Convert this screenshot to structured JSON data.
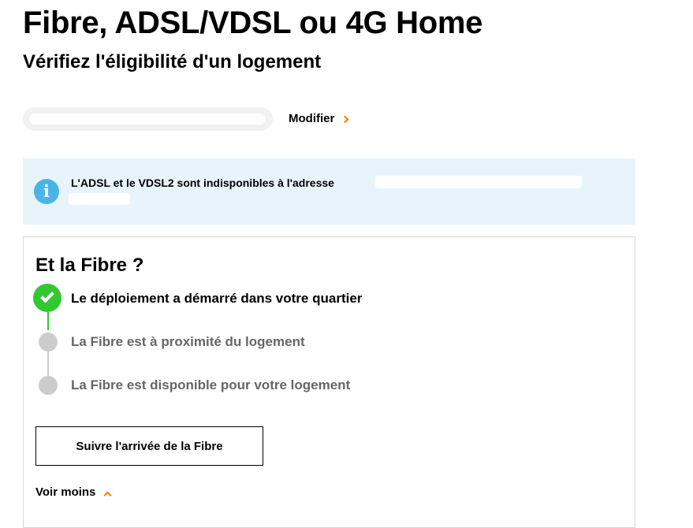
{
  "header": {
    "title": "Fibre, ADSL/VDSL ou 4G Home",
    "subtitle": "Vérifiez l'éligibilité d'un logement"
  },
  "address": {
    "modify_label": "Modifier",
    "modify_icon": "chevron-right-icon"
  },
  "info": {
    "icon": "info-icon",
    "icon_glyph": "i",
    "message": "L'ADSL et le VDSL2 sont indisponibles à l'adresse"
  },
  "fibre_card": {
    "title": "Et la Fibre ?",
    "steps": [
      {
        "label": "Le déploiement a démarré dans votre quartier",
        "status": "done"
      },
      {
        "label": "La Fibre est à proximité du logement",
        "status": "pending"
      },
      {
        "label": "La Fibre est disponible pour votre logement",
        "status": "pending"
      }
    ],
    "follow_button_label": "Suivre l'arrivée de la Fibre",
    "toggle_label": "Voir moins",
    "toggle_icon": "chevron-up-icon"
  },
  "colors": {
    "accent": "#ff7900",
    "success": "#32c832",
    "info": "#4bb4e6",
    "info_background": "#e8f4fb",
    "pending": "#cccccc"
  }
}
